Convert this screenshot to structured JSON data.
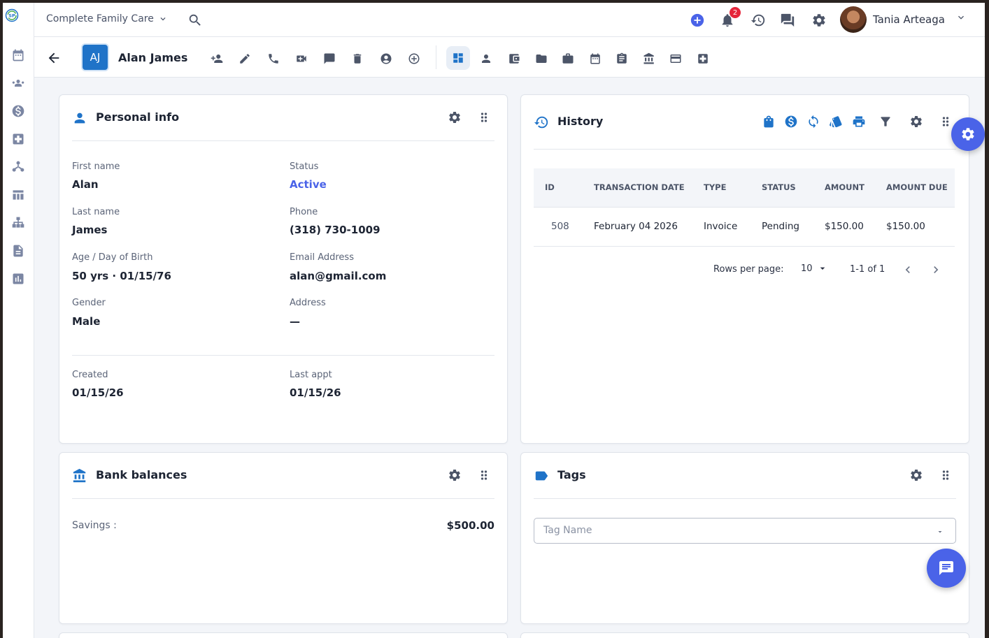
{
  "topbar": {
    "org_name": "Complete Family Care",
    "notif_count": "2",
    "user_name": "Tania Arteaga"
  },
  "patient": {
    "initials": "AJ",
    "name": "Alan James"
  },
  "personal_info": {
    "title": "Personal info",
    "first_name_label": "First name",
    "first_name": "Alan",
    "status_label": "Status",
    "status": "Active",
    "last_name_label": "Last name",
    "last_name": "James",
    "phone_label": "Phone",
    "phone": "(318) 730-1009",
    "age_label": "Age / Day of Birth",
    "age": "50 yrs · 01/15/76",
    "email_label": "Email Address",
    "email": "alan@gmail.com",
    "gender_label": "Gender",
    "gender": "Male",
    "address_label": "Address",
    "address": "—",
    "created_label": "Created",
    "created": "01/15/26",
    "last_appt_label": "Last appt",
    "last_appt": "01/15/26"
  },
  "history": {
    "title": "History",
    "columns": [
      "ID",
      "TRANSACTION DATE",
      "TYPE",
      "STATUS",
      "AMOUNT",
      "AMOUNT DUE"
    ],
    "rows": [
      [
        "508",
        "February 04 2026",
        "Invoice",
        "Pending",
        "$150.00",
        "$150.00"
      ]
    ],
    "rows_per_page_label": "Rows per page:",
    "rows_per_page": "10",
    "range": "1-1 of 1"
  },
  "bank": {
    "title": "Bank balances",
    "savings_label": "Savings :",
    "savings_value": "$500.00"
  },
  "tags": {
    "title": "Tags",
    "placeholder": "Tag Name"
  },
  "colors": {
    "accent": "#1f73c8",
    "fab": "#4a63e8",
    "status_active": "#4a63e8",
    "badge": "#e5253a"
  }
}
